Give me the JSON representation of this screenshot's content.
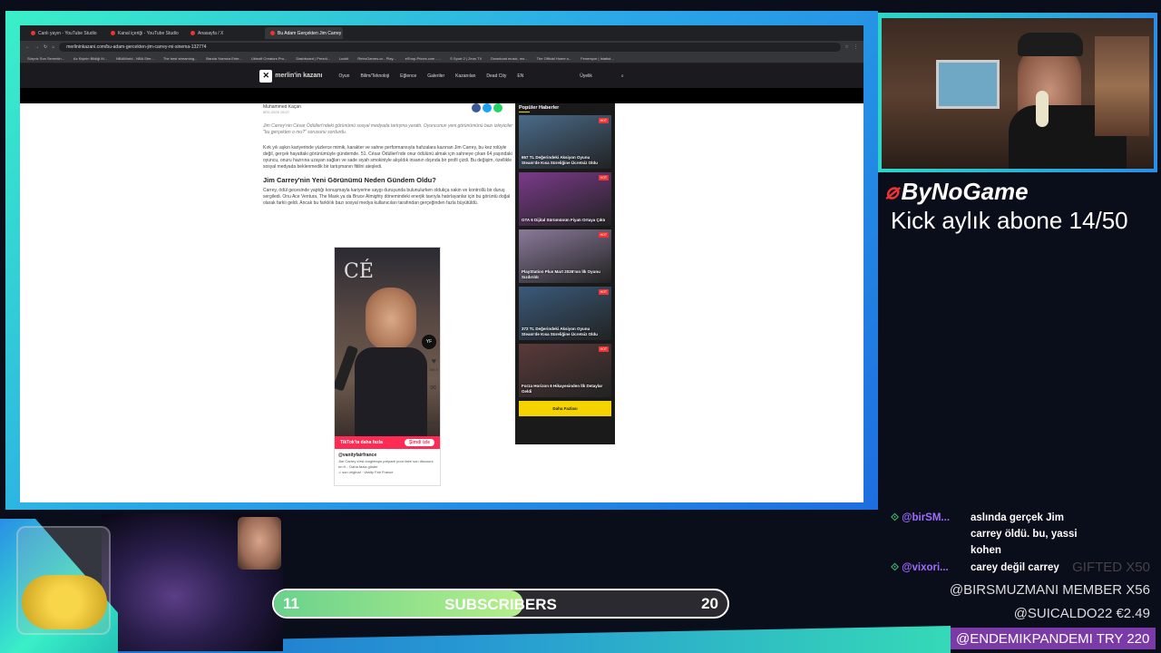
{
  "browser": {
    "tabs": [
      {
        "label": "Canlı yayın - YouTube Studio",
        "active": false
      },
      {
        "label": "Kanal içeriği - YouTube Studio",
        "active": false
      },
      {
        "label": "Anasayfa / X",
        "active": false
      },
      {
        "label": "Bu Adam Gerçekten Jim Carrey Mi...",
        "active": true
      }
    ],
    "url": "merlininkazani.com/bu-adam-gercekten-jim-carrey-mi-sinema-132774",
    "bookmarks": [
      "Sürpriz Son Seventin...",
      "Az Kişinin Bildiği M...",
      "NBAWorld - NBA Stre...",
      "The best streaming...",
      "Banda Yazmca Ente...",
      "Ubisoft Creators Pro...",
      "Dashboard | Prezdi...",
      "Luckit",
      "RetroGames.cc - Play...",
      "eShop-Prices.com - ...",
      "S Sport 2 | Zeus TV",
      "Download music, mo...",
      "The Official Home o...",
      "Fenerspor | İstatist..."
    ]
  },
  "site": {
    "logo": "merlin'in kazanı",
    "nav": [
      "Oyun",
      "Bilim/Teknoloji",
      "Eğlence",
      "Galeriler",
      "Kazanılan",
      "Dead City",
      "EN"
    ],
    "account": "Üyelik"
  },
  "article": {
    "author": "Muhammed Kaçan",
    "date": "5ED.2026 15:07",
    "lead": "Jim Carrey'nin César Ödülleri'ndeki görünümü sosyal medyada tartışma yarattı. Oyuncunun yeni görünümünü bazı izleyiciler \"bu gerçekten o mu?\" sorusunu sordurdu.",
    "p1": "Kırk yılı aşkın kariyerinde yüzlerce mimik, karakter ve sahne performansıyla hafızalara kazınan Jim Carrey, bu kez rolüyle değil, gerçek hayattaki görünümüyle gündemde. 51. César Ödülleri'nde onur ödülünü almak için sahneye çıkan 64 yaşındaki oyuncu, onuru hazırına uzayan sağları ve sade siyah smokiniyle alışıldık insanın dışında bir profil çizdi. Bu değişim, özellikle sosyal medyada beklenmedik bir tartışmanın fitilini ateşledi.",
    "h2": "Jim Carrey'nin Yeni Görünümü Neden Gündem Oldu?",
    "p2": "Carrey, ödül gecesinde yaptığı konuşmayla kariyerine saygı duruşunda bulunulurken oldukça sakin ve kontrollü bir duruş sergiledi. Onu Ace Ventura, The Mask ya da Bruce Almighty dönemindeki enerjik tavrıyla hatırlayanlar için bu görüntü doğal olarak farklı geldi. Ancak bu farklılık bazı sosyal medya kullanıcıları tarafından gerçeğinden fazla büyütüldü.",
    "tiktok": {
      "bar_text": "TikTok'ta daha fazla",
      "button": "Şimdi izle",
      "user": "@vanityfairfrance",
      "desc": "Jim Carrey s'est longtemps préparé pour faire son discours en fr... Daha fazla göster",
      "sound": "son original · Vanity Fair France",
      "likes": "346.9",
      "comments": "101.0K"
    }
  },
  "sidebar": {
    "title": "Popüler Haberler",
    "cards": [
      {
        "title": "657 TL Değerindeki Aksiyon Oyunu Steam'de Kısa Süreliğine Ücretsiz Oldu",
        "color": "#4a6b8a"
      },
      {
        "title": "GTA 6 Dijital Sürümünün Fiyatı Ortaya Çıktı",
        "color": "#7a3a8a"
      },
      {
        "title": "PlayStation Plus Mart 2026'nın İlk Oyunu Sızdırıldı",
        "color": "#8a7a9a"
      },
      {
        "title": "372 TL Değerindeki Aksiyon Oyunu Steam'de Kısa Süreliğine Ücretsiz Oldu",
        "color": "#3a5a7a"
      },
      {
        "title": "Forza Horizon 6 Hikayesinden İlk Detaylar Geldi",
        "color": "#5a3a3a"
      }
    ],
    "more": "Daha Fazlası"
  },
  "overlay": {
    "brand": "ByNoGame",
    "kick_goal": "Kick aylık abone 14/50",
    "chat": [
      {
        "user": "@birSM...",
        "message": "aslında gerçek Jim carrey öldü. bu, yassi kohen"
      },
      {
        "user": "@vixori...",
        "message": "carey değil carrey"
      }
    ],
    "events": [
      {
        "text": "GIFTED X50",
        "faded": true
      },
      {
        "text": "@BIRSMUZMANI  MEMBER X56",
        "faded": false
      },
      {
        "text": "@SUICALDO22  €2.49",
        "faded": false
      }
    ],
    "event_highlight": "@ENDEMIKPANDEMI  TRY 220",
    "sub_goal": {
      "current": "11",
      "label": "SUBSCRIBERS",
      "target": "20",
      "progress": 0.55
    }
  },
  "colors": {
    "accent_teal": "#3af0c8",
    "accent_blue": "#2a8ee6",
    "brand_red": "#e33333",
    "tiktok_pink": "#fe2c55",
    "site_yellow": "#f5d300"
  }
}
